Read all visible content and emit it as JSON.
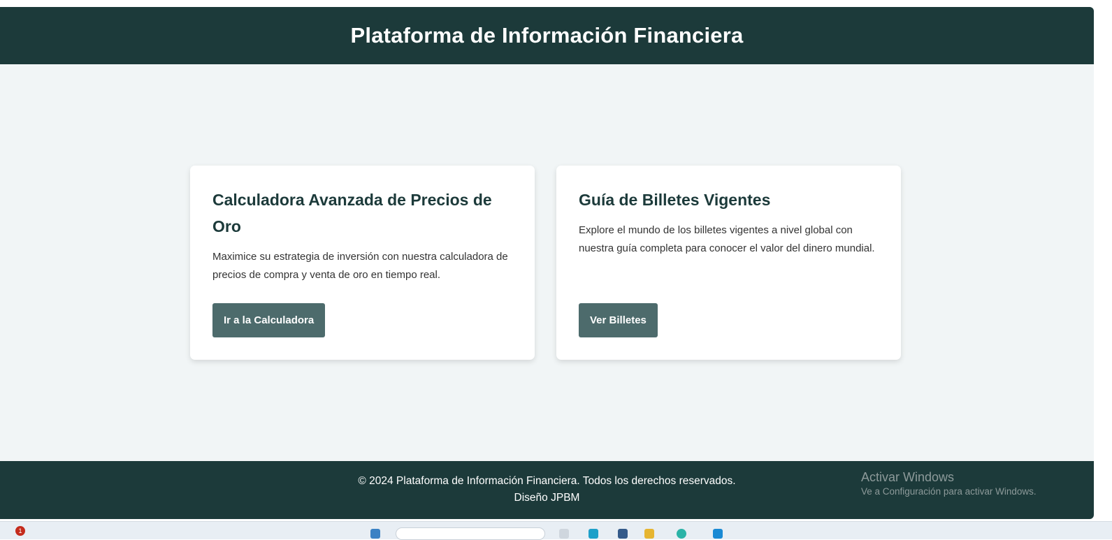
{
  "header": {
    "title": "Plataforma de Información Financiera"
  },
  "cards": [
    {
      "title": "Calculadora Avanzada de Precios de Oro",
      "description": "Maximice su estrategia de inversión con nuestra calculadora de precios de compra y venta de oro en tiempo real.",
      "button_label": "Ir a la Calculadora"
    },
    {
      "title": "Guía de Billetes Vigentes",
      "description": "Explore el mundo de los billetes vigentes a nivel global con nuestra guía completa para conocer el valor del dinero mundial.",
      "button_label": "Ver Billetes"
    }
  ],
  "footer": {
    "copyright": "© 2024 Plataforma de Información Financiera. Todos los derechos reservados.",
    "credit": "Diseño JPBM"
  },
  "watermark": {
    "title": "Activar Windows",
    "subtitle": "Ve a Configuración para activar Windows."
  },
  "taskbar": {
    "notification_count": "1"
  },
  "colors": {
    "header_bg": "#1c3a3a",
    "page_bg": "#f1f5f6",
    "button_bg": "#4d6b6c",
    "card_title": "#1c3a3a"
  }
}
